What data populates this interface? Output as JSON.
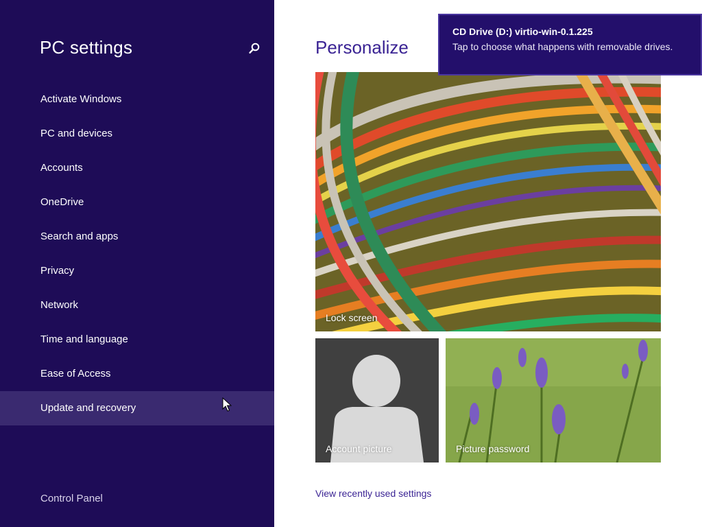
{
  "window": {
    "title": "PC settings"
  },
  "sidebar": {
    "title": "PC settings",
    "search_icon": "search-icon",
    "items": [
      {
        "label": "Activate Windows"
      },
      {
        "label": "PC and devices"
      },
      {
        "label": "Accounts"
      },
      {
        "label": "OneDrive"
      },
      {
        "label": "Search and apps"
      },
      {
        "label": "Privacy"
      },
      {
        "label": "Network"
      },
      {
        "label": "Time and language"
      },
      {
        "label": "Ease of Access"
      },
      {
        "label": "Update and recovery",
        "hovered": true
      }
    ],
    "footer_link": "Control Panel"
  },
  "main": {
    "title": "Personalize",
    "tiles": {
      "lock_screen": {
        "label": "Lock screen"
      },
      "account_picture": {
        "label": "Account picture"
      },
      "picture_password": {
        "label": "Picture password"
      }
    },
    "recent_link": "View recently used settings"
  },
  "toast": {
    "title": "CD Drive (D:) virtio-win-0.1.225",
    "body": "Tap to choose what happens with removable drives."
  },
  "colors": {
    "sidebar_bg": "#1e0c57",
    "sidebar_hover": "#3a2a70",
    "accent": "#3b2494",
    "toast_bg": "#230f6b"
  }
}
